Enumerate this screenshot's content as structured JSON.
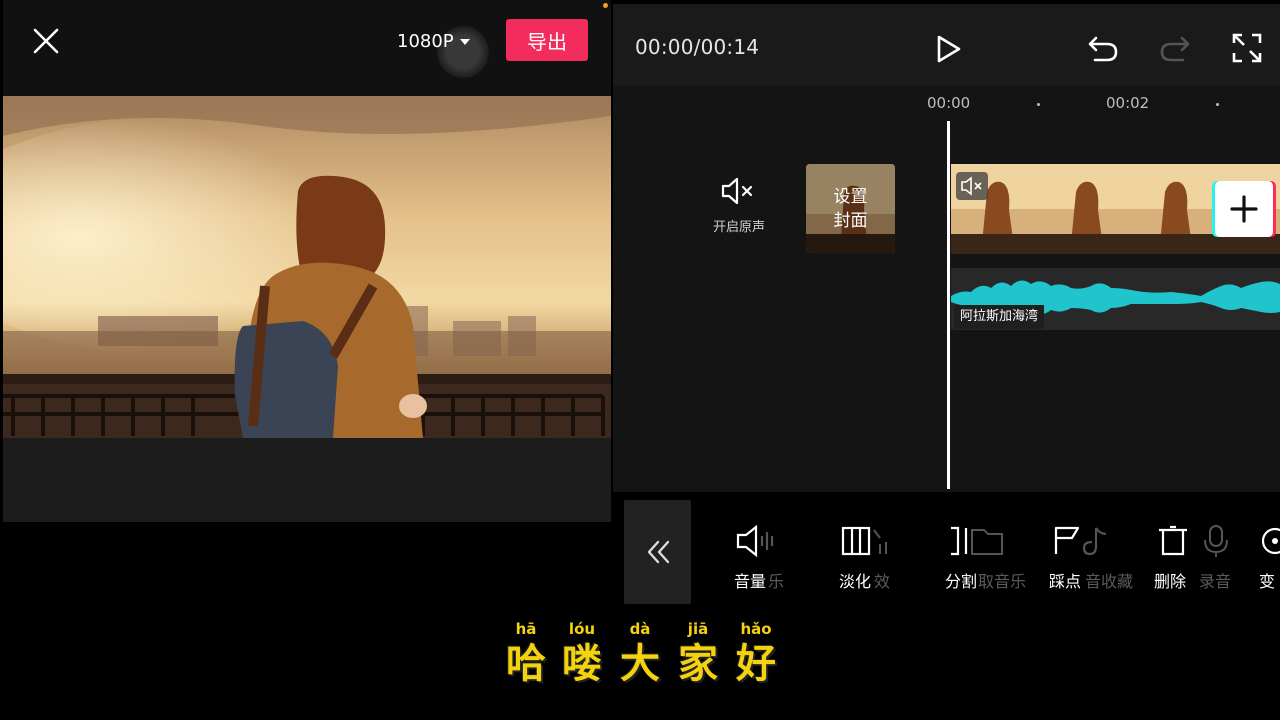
{
  "preview": {
    "resolution": "1080P",
    "export_label": "导出",
    "close_icon": "close-icon"
  },
  "editor": {
    "timecode": "00:00/00:14",
    "ruler_ticks": [
      "00:00",
      "00:02"
    ],
    "unmute_label": "开启原声",
    "cover_label": "设置\n封面",
    "audio_name": "阿拉斯加海湾"
  },
  "toolbar": {
    "collapse_icon": "double-chevron-left-icon",
    "tools": [
      {
        "label": "音量",
        "icon": "volume-icon",
        "ghost": "乐"
      },
      {
        "label": "淡化",
        "icon": "fade-icon",
        "ghost": "效"
      },
      {
        "label": "分割",
        "icon": "split-icon",
        "ghost": "取音乐"
      },
      {
        "label": "踩点",
        "icon": "flag-icon",
        "ghost": "音收藏"
      },
      {
        "label": "删除",
        "icon": "delete-icon",
        "ghost": "录音"
      },
      {
        "label": "变",
        "icon": "speed-icon",
        "ghost": ""
      }
    ]
  },
  "subtitle": [
    {
      "pinyin": "hā",
      "char": "哈"
    },
    {
      "pinyin": "lóu",
      "char": "喽"
    },
    {
      "pinyin": "dà",
      "char": "大"
    },
    {
      "pinyin": "jiā",
      "char": "家"
    },
    {
      "pinyin": "hǎo",
      "char": "好"
    }
  ],
  "colors": {
    "accent": "#f22c5c",
    "subtitle": "#f4d20e",
    "waveform": "#20c4cc"
  }
}
